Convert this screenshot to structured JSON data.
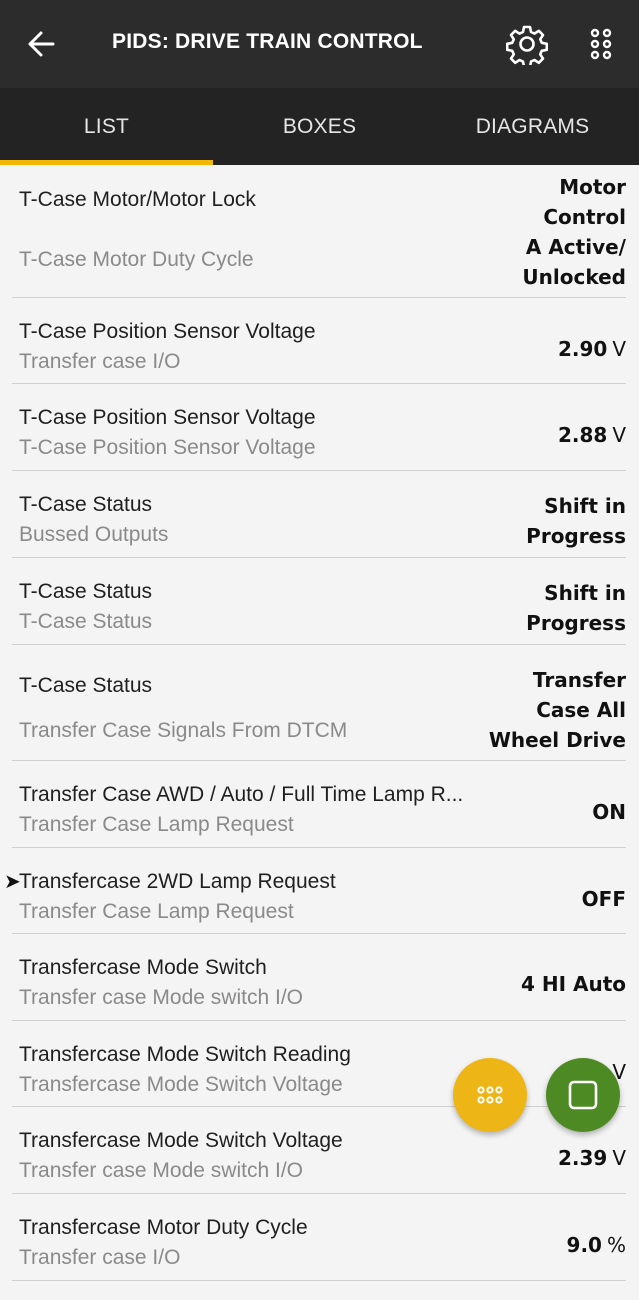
{
  "header": {
    "title": "PIDS: DRIVE TRAIN CONTROL",
    "back_icon": "arrow-left-icon",
    "settings_icon": "gear-icon",
    "more_icon": "dots-grid-icon"
  },
  "tabs": [
    {
      "label": "LIST",
      "active": true
    },
    {
      "label": "BOXES",
      "active": false
    },
    {
      "label": "DIAGRAMS",
      "active": false
    }
  ],
  "colors": {
    "topbar": "#2c2c2c",
    "tabbar": "#232323",
    "accent": "#f2b705",
    "fab_yellow": "#eeb516",
    "fab_green": "#4d8a24"
  },
  "rows": [
    {
      "name": "T-Case Motor/Motor Lock",
      "sub": "T-Case Motor Duty Cycle",
      "value": "Motor\nControl\nA Active/\nUnlocked",
      "unit": ""
    },
    {
      "name": "T-Case Position Sensor Voltage",
      "sub": "Transfer case I/O",
      "value": "2.90",
      "unit": "V"
    },
    {
      "name": "T-Case Position Sensor Voltage",
      "sub": "T-Case Position Sensor Voltage",
      "value": "2.88",
      "unit": "V"
    },
    {
      "name": "T-Case Status",
      "sub": "Bussed Outputs",
      "value": "Shift in\nProgress",
      "unit": ""
    },
    {
      "name": "T-Case Status",
      "sub": "T-Case Status",
      "value": "Shift in\nProgress",
      "unit": ""
    },
    {
      "name": "T-Case Status",
      "sub": "Transfer Case Signals From DTCM",
      "value": "Transfer\nCase All\nWheel Drive",
      "unit": ""
    },
    {
      "name": "Transfer Case AWD / Auto / Full Time Lamp R...",
      "sub": "Transfer Case Lamp Request",
      "value": "ON",
      "unit": ""
    },
    {
      "name": "Transfercase 2WD Lamp Request",
      "sub": "Transfer Case Lamp Request",
      "value": "OFF",
      "unit": "",
      "pointer": "➤"
    },
    {
      "name": "Transfercase Mode Switch",
      "sub": "Transfer case Mode switch I/O",
      "value": "4 HI Auto",
      "unit": ""
    },
    {
      "name": "Transfercase Mode Switch Reading",
      "sub": "Transfercase Mode Switch Voltage",
      "value": "",
      "unit": "V"
    },
    {
      "name": "Transfercase Mode Switch Voltage",
      "sub": "Transfer case Mode switch I/O",
      "value": "2.39",
      "unit": "V"
    },
    {
      "name": "Transfercase Motor Duty Cycle",
      "sub": "Transfer case I/O",
      "value": "9.0",
      "unit": "%"
    }
  ],
  "fabs": {
    "yellow_icon": "dots-grid-icon",
    "green_icon": "stop-square-icon"
  }
}
